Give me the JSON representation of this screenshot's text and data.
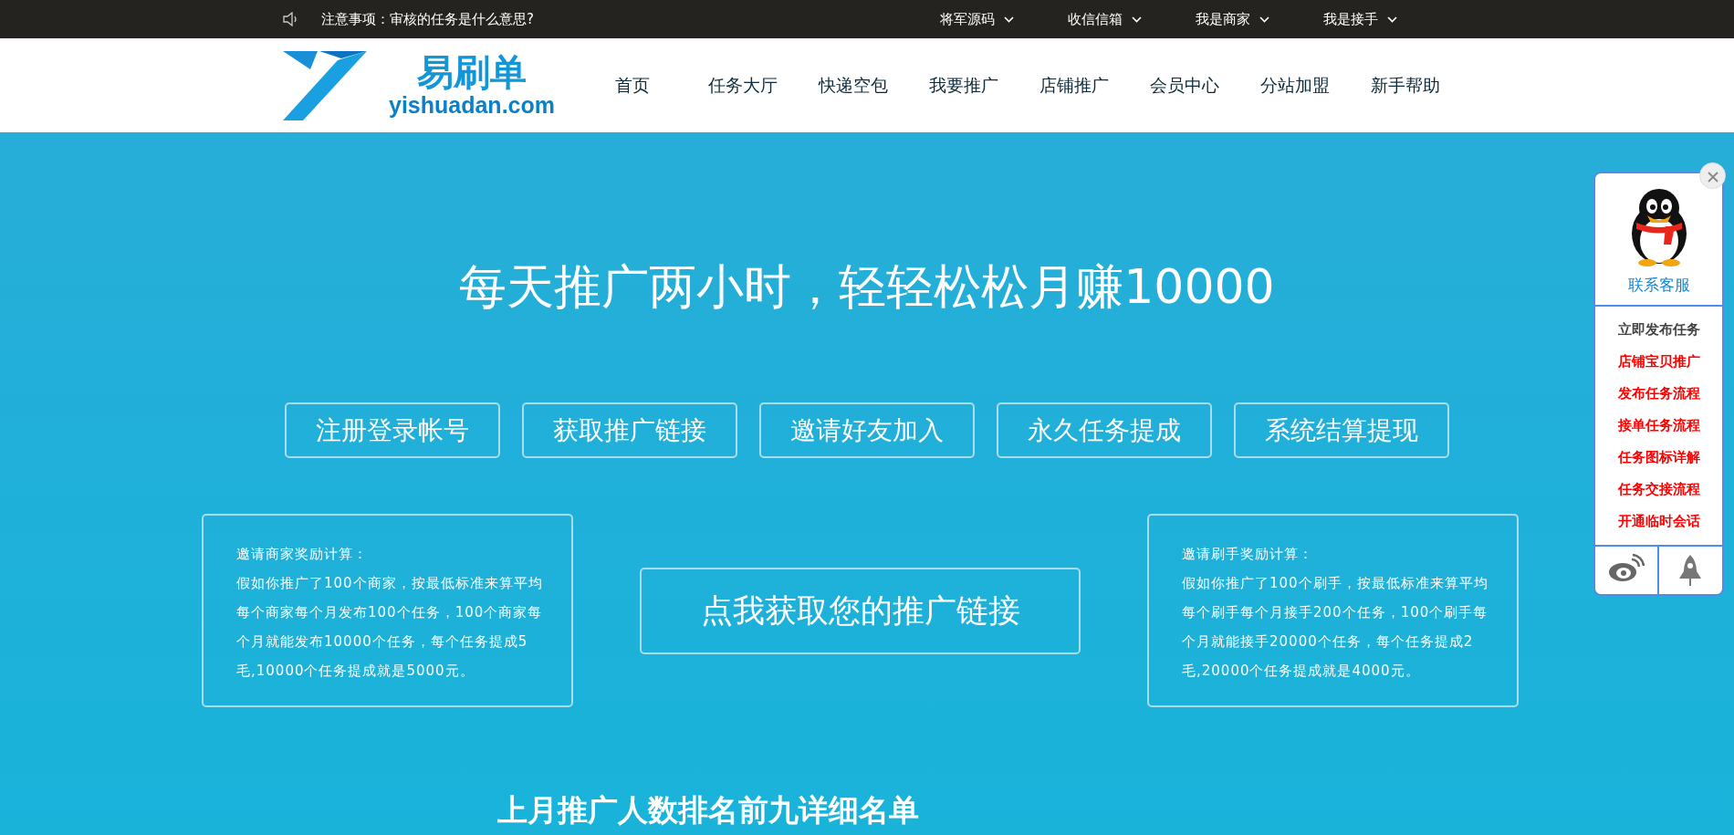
{
  "notice": {
    "text": "注意事项：审核的任务是什么意思?"
  },
  "top_links": [
    {
      "label": "将军源码"
    },
    {
      "label": "收信信箱"
    },
    {
      "label": "我是商家"
    },
    {
      "label": "我是接手"
    }
  ],
  "logo": {
    "name": "易刷单",
    "domain": "yishuadan.com"
  },
  "nav": [
    "首页",
    "任务大厅",
    "快递空包",
    "我要推广",
    "店铺推广",
    "会员中心",
    "分站加盟",
    "新手帮助"
  ],
  "hero": {
    "headline": "每天推广两小时，轻轻松松月赚10000",
    "steps": [
      "注册登录帐号",
      "获取推广链接",
      "邀请好友加入",
      "永久任务提成",
      "系统结算提现"
    ],
    "cta": "点我获取您的推广链接",
    "reward_boxes": [
      {
        "title": "邀请商家奖励计算：",
        "body": "假如你推广了100个商家，按最低标准来算平均每个商家每个月发布100个任务，100个商家每个月就能发布10000个任务，每个任务提成5毛,10000个任务提成就是5000元。"
      },
      {
        "title": "邀请刷手奖励计算：",
        "body": "假如你推广了100个刷手，按最低标准来算平均每个刷手每个月接手200个任务，100个刷手每个月就能接手20000个任务，每个任务提成2毛,20000个任务提成就是4000元。"
      }
    ],
    "ranking_title": "上月推广人数排名前九详细名单"
  },
  "side_panel": {
    "contact": "联系客服",
    "links": [
      {
        "label": "立即发布任务",
        "highlighted": false
      },
      {
        "label": "店铺宝贝推广",
        "highlighted": true
      },
      {
        "label": "发布任务流程",
        "highlighted": true
      },
      {
        "label": "接单任务流程",
        "highlighted": true
      },
      {
        "label": "任务图标详解",
        "highlighted": true
      },
      {
        "label": "任务交接流程",
        "highlighted": true
      },
      {
        "label": "开通临时会话",
        "highlighted": true
      }
    ]
  }
}
